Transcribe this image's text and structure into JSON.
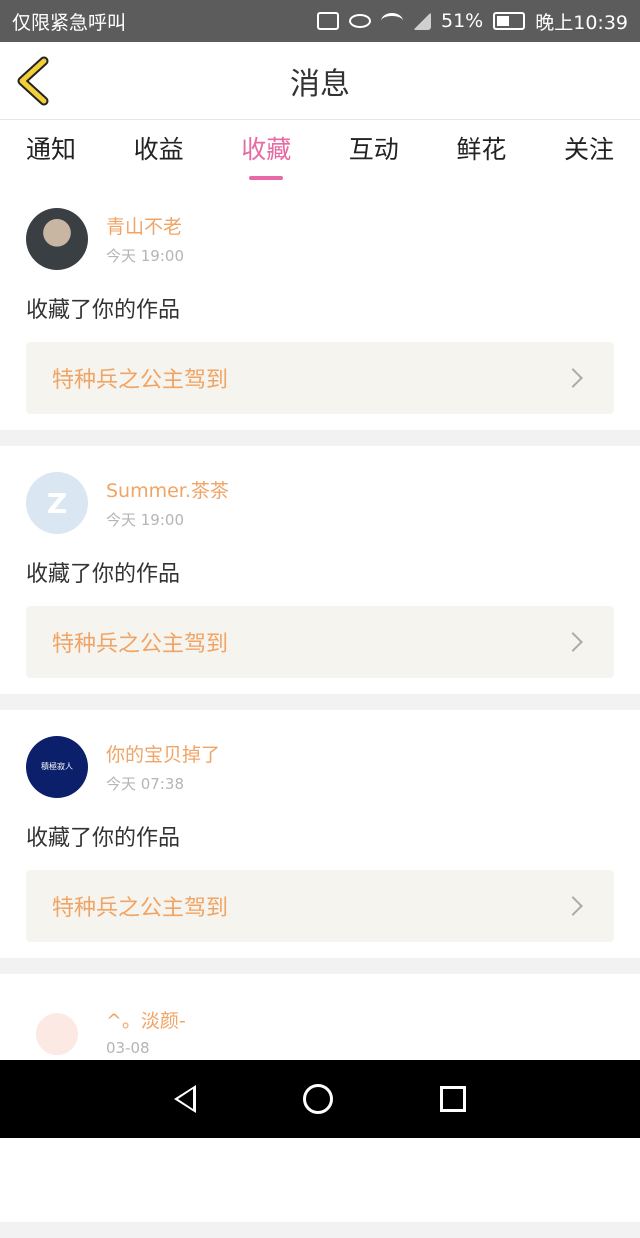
{
  "statusbar": {
    "left_text": "仅限紧急呼叫",
    "battery": "51%",
    "time": "晚上10:39"
  },
  "header": {
    "title": "消息"
  },
  "tabs": [
    {
      "label": "通知"
    },
    {
      "label": "收益"
    },
    {
      "label": "收藏",
      "active": true
    },
    {
      "label": "互动"
    },
    {
      "label": "鲜花"
    },
    {
      "label": "关注"
    }
  ],
  "messages": [
    {
      "user": "青山不老",
      "time": "今天 19:00",
      "action": "收藏了你的作品",
      "work": "特种兵之公主驾到"
    },
    {
      "user": "Summer.茶茶",
      "time": "今天 19:00",
      "action": "收藏了你的作品",
      "work": "特种兵之公主驾到"
    },
    {
      "user": "你的宝贝掉了",
      "time": "今天 07:38",
      "action": "收藏了你的作品",
      "work": "特种兵之公主驾到",
      "avatar_text": "積極寂人"
    },
    {
      "user": "^。淡颜-",
      "time": "03-08"
    }
  ],
  "colors": {
    "accent_pink": "#e76aa6",
    "username_orange": "#f0a466"
  }
}
